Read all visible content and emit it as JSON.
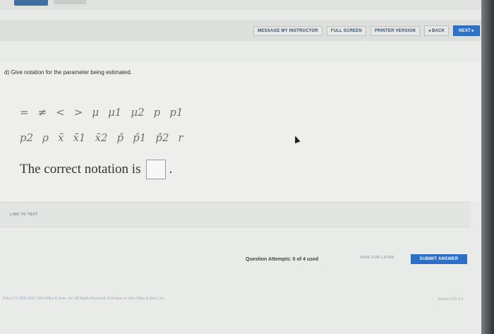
{
  "toolbar": {
    "message_instructor": "MESSAGE MY INSTRUCTOR",
    "full_screen": "FULL SCREEN",
    "printer_version": "PRINTER VERSION",
    "back": "◂ BACK",
    "next": "NEXT ▸"
  },
  "question": {
    "prompt": "d) Give notation for the parameter being estimated.",
    "symbols_row1": [
      "=",
      "≠",
      "<",
      ">",
      "μ",
      "μ1",
      "μ2",
      "p",
      "p1"
    ],
    "symbols_row2": [
      "p2",
      "ρ",
      "x̄",
      "x̄1",
      "x̄2",
      "p̂",
      "p̂1",
      "p̂2",
      "r"
    ],
    "statement": "The correct notation is",
    "period": "."
  },
  "link_to_text": "LINK TO TEXT",
  "attempts": "Question Attempts: 0 of 4 used",
  "save_for_later": "SAVE FOR LATER",
  "submit_answer": "SUBMIT ANSWER",
  "footer": {
    "text": "Policy  |  © 2000-2017 John Wiley & Sons, Inc. All Rights Reserved. A Division of John Wiley & Sons, Inc.",
    "version": "Version 4.22.3.5"
  }
}
